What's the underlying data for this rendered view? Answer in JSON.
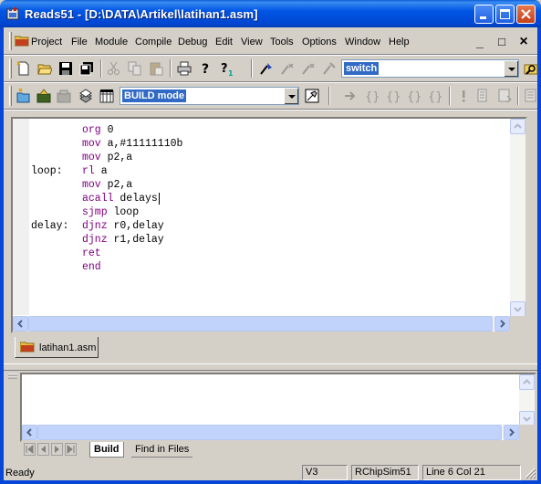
{
  "window": {
    "title": "Reads51 - [D:\\DATA\\Artikel\\latihan1.asm]"
  },
  "menu": {
    "items": [
      "Project",
      "File",
      "Module",
      "Compile",
      "Debug",
      "Edit",
      "View",
      "Tools",
      "Options",
      "Window",
      "Help"
    ],
    "mdi_buttons": [
      "_",
      "□",
      "×"
    ]
  },
  "toolbar1": {
    "search_combo_value": "switch",
    "icons": [
      "new-file-icon",
      "open-folder-icon",
      "save-icon",
      "save-all-icon",
      "cut-icon",
      "copy-icon",
      "paste-icon",
      "print-icon",
      "help-icon",
      "context-help-icon",
      "find-icon",
      "find-next-icon",
      "find-prev-icon",
      "replace-icon",
      "find-in-files-icon"
    ]
  },
  "toolbar2": {
    "build_combo_value": "BUILD mode",
    "icons": [
      "new-project-icon",
      "open-project-icon",
      "close-project-icon",
      "build-icon",
      "build-all-icon",
      "options-icon",
      "run-icon",
      "step-into-icon",
      "step-over-icon",
      "step-out-icon",
      "run-to-cursor-icon",
      "breakpoint-icon",
      "watch-icon",
      "memory-icon"
    ]
  },
  "editor": {
    "code_lines": [
      {
        "label": "",
        "mnemonic": "org",
        "operands": "0"
      },
      {
        "label": "",
        "mnemonic": "mov",
        "operands": "a,#11111110b"
      },
      {
        "label": "",
        "mnemonic": "mov",
        "operands": "p2,a"
      },
      {
        "label": "loop:",
        "mnemonic": "rl",
        "operands": "a"
      },
      {
        "label": "",
        "mnemonic": "mov",
        "operands": "p2,a"
      },
      {
        "label": "",
        "mnemonic": "acall",
        "operands": "delays"
      },
      {
        "label": "",
        "mnemonic": "sjmp",
        "operands": "loop"
      },
      {
        "label": "delay:",
        "mnemonic": "djnz",
        "operands": "r0,delay"
      },
      {
        "label": "",
        "mnemonic": "djnz",
        "operands": "r1,delay"
      },
      {
        "label": "",
        "mnemonic": "ret",
        "operands": ""
      },
      {
        "label": "",
        "mnemonic": "end",
        "operands": ""
      }
    ],
    "colors": {
      "mnemonic": "#800080",
      "text": "#000000"
    }
  },
  "file_tab": {
    "label": "latihan1.asm"
  },
  "output": {
    "tabs": [
      "Build",
      "Find in Files"
    ],
    "active_tab": "Build"
  },
  "statusbar": {
    "ready": "Ready",
    "version": "V3",
    "simulator": "RChipSim51",
    "position": "Line 6 Col 21"
  }
}
